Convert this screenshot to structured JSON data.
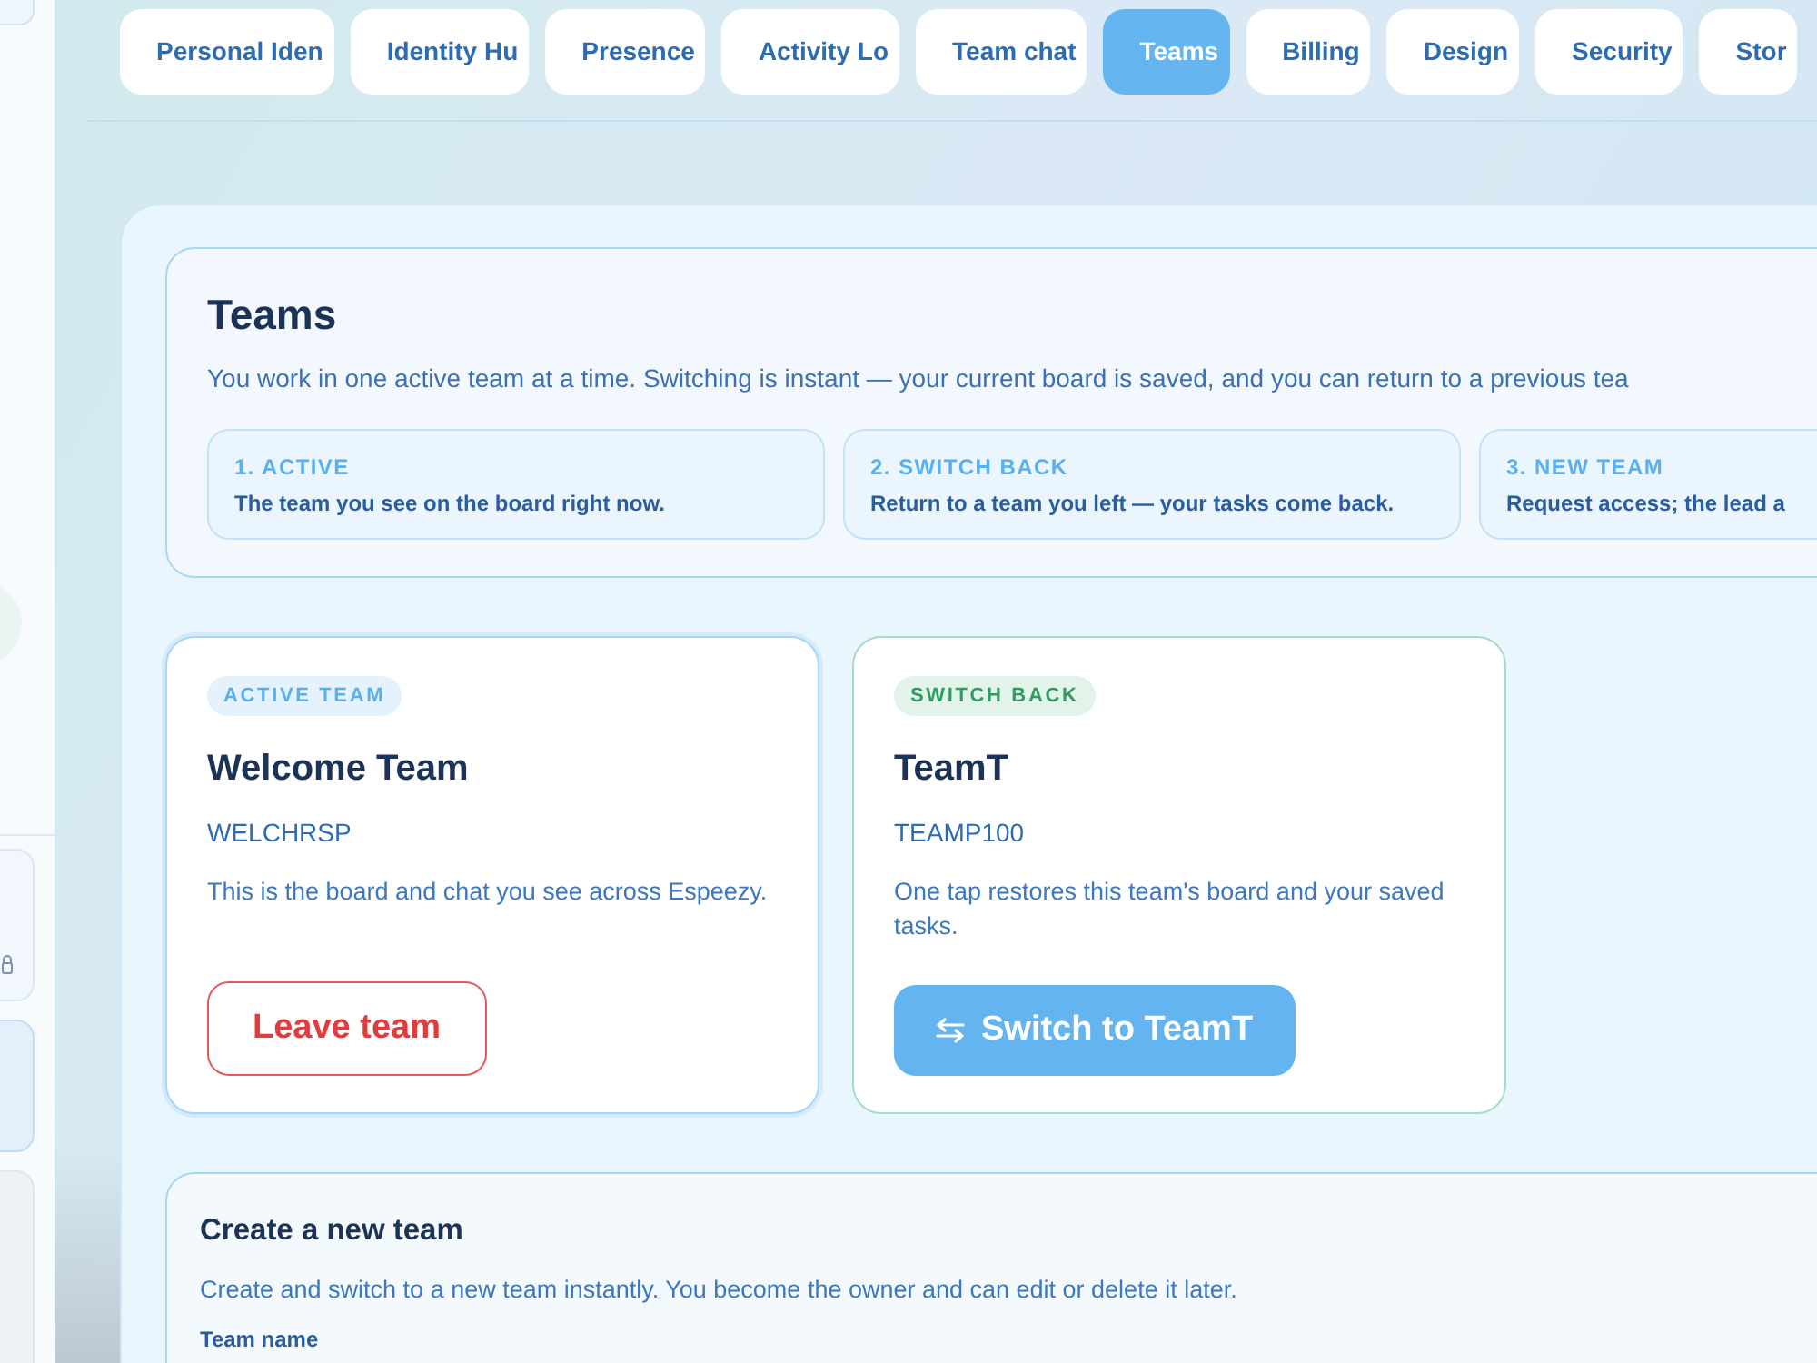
{
  "tabs": [
    {
      "label": "Personal Iden",
      "selected": false
    },
    {
      "label": "Identity Hu",
      "selected": false
    },
    {
      "label": "Presence",
      "selected": false
    },
    {
      "label": "Activity Lo",
      "selected": false
    },
    {
      "label": "Team chat",
      "selected": false
    },
    {
      "label": "Teams",
      "selected": true
    },
    {
      "label": "Billing",
      "selected": false
    },
    {
      "label": "Design",
      "selected": false
    },
    {
      "label": "Security",
      "selected": false
    },
    {
      "label": "Stor",
      "selected": false
    }
  ],
  "intro": {
    "title": "Teams",
    "description": "You work in one active team at a time. Switching is instant — your current board is saved, and you can return to a previous tea",
    "steps": [
      {
        "label": "1. ACTIVE",
        "text": "The team you see on the board right now."
      },
      {
        "label": "2. SWITCH BACK",
        "text": "Return to a team you left — your tasks come back."
      },
      {
        "label": "3. NEW TEAM",
        "text": "Request access; the lead a"
      }
    ]
  },
  "teams": [
    {
      "kind": "active",
      "badge": "ACTIVE TEAM",
      "name": "Welcome Team",
      "code": "WELCHRSP",
      "description": "This is the board and chat you see across Espeezy.",
      "button": "Leave team"
    },
    {
      "kind": "switch",
      "badge": "SWITCH BACK",
      "name": "TeamT",
      "code": "TEAMP100",
      "description": "One tap restores this team's board and your saved tasks.",
      "button": "Switch to TeamT"
    }
  ],
  "create": {
    "title": "Create a new team",
    "description": "Create and switch to a new team instantly. You become the owner and can edit or delete it later.",
    "field_label": "Team name"
  }
}
